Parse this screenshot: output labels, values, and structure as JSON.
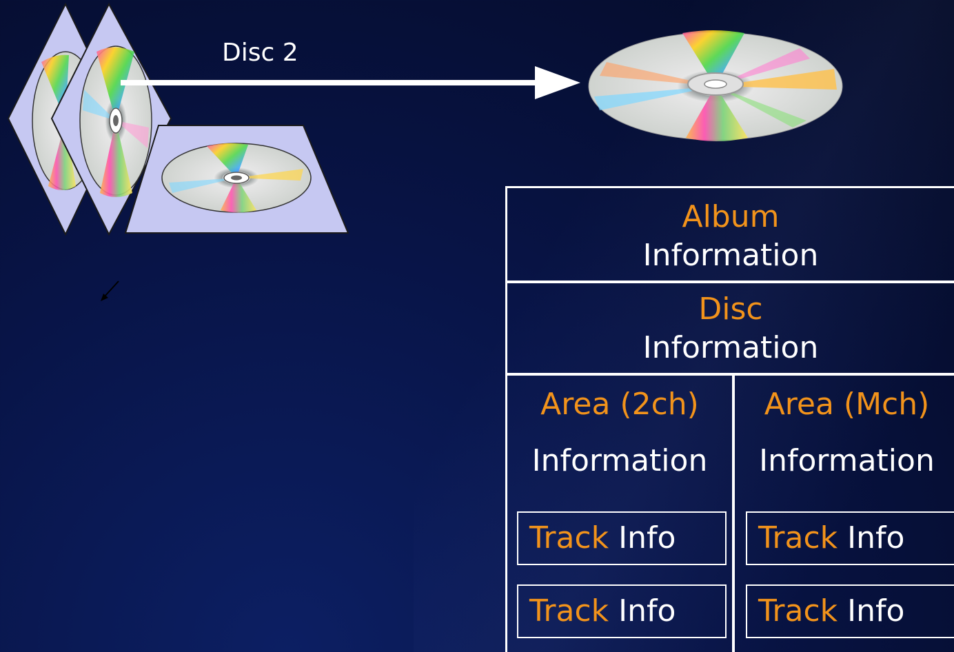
{
  "arrow_label": "Disc 2",
  "album": {
    "word": "Album",
    "info": "Information"
  },
  "disc": {
    "word": "Disc",
    "info": "Information"
  },
  "areas": [
    {
      "title": "Area (2ch)",
      "info": "Information",
      "tracks": [
        {
          "word": "Track",
          "info": "Info"
        },
        {
          "word": "Track",
          "info": "Info"
        }
      ]
    },
    {
      "title": "Area (Mch)",
      "info": "Information",
      "tracks": [
        {
          "word": "Track",
          "info": "Info"
        },
        {
          "word": "Track",
          "info": "Info"
        }
      ]
    }
  ],
  "colors": {
    "accent": "#f2931b",
    "text": "#ffffff",
    "card": "#c6c8f2",
    "background": "#081447"
  }
}
